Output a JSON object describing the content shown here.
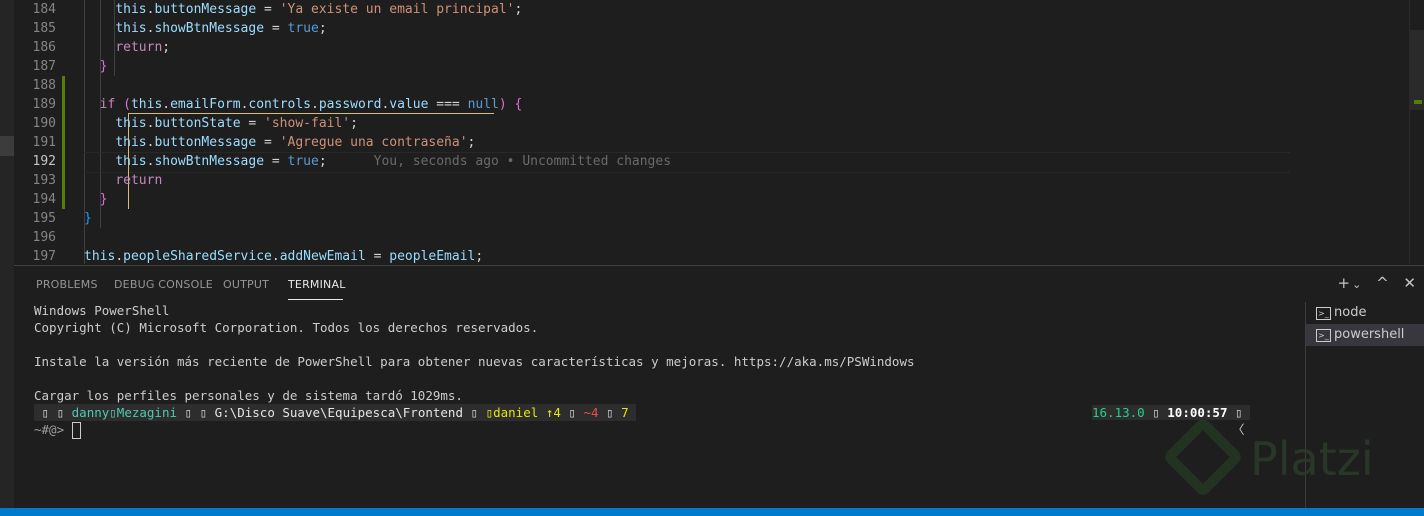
{
  "editor": {
    "lines": [
      {
        "n": "184",
        "indent": "    ",
        "tokens": [
          [
            "prop",
            "this"
          ],
          [
            "d",
            "."
          ],
          [
            "prop",
            "buttonMessage"
          ],
          [
            "d",
            " = "
          ],
          [
            "str",
            "'Ya existe un email principal'"
          ],
          [
            "d",
            ";"
          ]
        ]
      },
      {
        "n": "185",
        "indent": "    ",
        "tokens": [
          [
            "prop",
            "this"
          ],
          [
            "d",
            "."
          ],
          [
            "prop",
            "showBtnMessage"
          ],
          [
            "d",
            " = "
          ],
          [
            "kw",
            "true"
          ],
          [
            "d",
            ";"
          ]
        ]
      },
      {
        "n": "186",
        "indent": "    ",
        "tokens": [
          [
            "ctl",
            "return"
          ],
          [
            "d",
            ";"
          ]
        ]
      },
      {
        "n": "187",
        "indent": "  ",
        "tokens": [
          [
            "brace2",
            "}"
          ]
        ]
      },
      {
        "n": "188",
        "indent": "",
        "tokens": []
      },
      {
        "n": "189",
        "indent": "  ",
        "tokens": [
          [
            "ctl",
            "if"
          ],
          [
            "d",
            " "
          ],
          [
            "brace2",
            "("
          ],
          [
            "prop",
            "this"
          ],
          [
            "d",
            "."
          ],
          [
            "prop",
            "emailForm"
          ],
          [
            "d",
            "."
          ],
          [
            "prop",
            "controls"
          ],
          [
            "d",
            "."
          ],
          [
            "prop",
            "password"
          ],
          [
            "d",
            "."
          ],
          [
            "prop",
            "value"
          ],
          [
            "d",
            " === "
          ],
          [
            "kw",
            "null"
          ],
          [
            "brace2",
            ")"
          ],
          [
            "d",
            " "
          ],
          [
            "brace2",
            "{"
          ]
        ]
      },
      {
        "n": "190",
        "indent": "    ",
        "tokens": [
          [
            "prop",
            "this"
          ],
          [
            "d",
            "."
          ],
          [
            "prop",
            "buttonState"
          ],
          [
            "d",
            " = "
          ],
          [
            "str",
            "'show-fail'"
          ],
          [
            "d",
            ";"
          ]
        ]
      },
      {
        "n": "191",
        "indent": "    ",
        "tokens": [
          [
            "prop",
            "this"
          ],
          [
            "d",
            "."
          ],
          [
            "prop",
            "buttonMessage"
          ],
          [
            "d",
            " = "
          ],
          [
            "str",
            "'Agregue una contraseña'"
          ],
          [
            "d",
            ";"
          ]
        ]
      },
      {
        "n": "192",
        "indent": "    ",
        "tokens": [
          [
            "prop",
            "this"
          ],
          [
            "d",
            "."
          ],
          [
            "prop",
            "showBtnMessage"
          ],
          [
            "d",
            " = "
          ],
          [
            "kw",
            "true"
          ],
          [
            "d",
            ";"
          ]
        ],
        "blame": "You, seconds ago • Uncommitted changes"
      },
      {
        "n": "193",
        "indent": "    ",
        "tokens": [
          [
            "ctl",
            "return"
          ]
        ]
      },
      {
        "n": "194",
        "indent": "  ",
        "tokens": [
          [
            "brace2",
            "}"
          ]
        ]
      },
      {
        "n": "195",
        "indent": "",
        "tokens": [
          [
            "brace3",
            "}"
          ]
        ]
      },
      {
        "n": "196",
        "indent": "",
        "tokens": []
      },
      {
        "n": "197",
        "indent": "",
        "tokens": [
          [
            "prop",
            "this"
          ],
          [
            "d",
            "."
          ],
          [
            "prop",
            "peopleSharedService"
          ],
          [
            "d",
            "."
          ],
          [
            "prop",
            "addNewEmail"
          ],
          [
            "d",
            " = "
          ],
          [
            "prop",
            "peopleEmail"
          ],
          [
            "d",
            ";"
          ]
        ]
      }
    ],
    "active_line": "192"
  },
  "panel": {
    "tabs": [
      {
        "label": "PROBLEMS",
        "active": false
      },
      {
        "label": "DEBUG CONSOLE",
        "active": false
      },
      {
        "label": "OUTPUT",
        "active": false
      },
      {
        "label": "TERMINAL",
        "active": true
      }
    ],
    "actions": {
      "add": "+",
      "dropdown": "⌄",
      "maximize": "^",
      "close": "✕"
    }
  },
  "terminal": {
    "lines": [
      "Windows PowerShell",
      "Copyright (C) Microsoft Corporation. Todos los derechos reservados.",
      "",
      "Instale la versión más reciente de PowerShell para obtener nuevas características y mejoras. https://aka.ms/PSWindows",
      "",
      "Cargar los perfiles personales y de sistema tardó 1029ms."
    ],
    "prompt": {
      "user": "danny▯Mezagini",
      "path": "G:\\Disco Suave\\Equipesca\\Frontend",
      "branch": "▯daniel",
      "ahead": "↑4",
      "modified": "~4",
      "count": "7",
      "node_version": "16.13.0",
      "time": "10:00:57",
      "second_line": "~#@>",
      "right_glyph": "〈"
    },
    "instances": [
      {
        "label": "node",
        "selected": false
      },
      {
        "label": "powershell",
        "selected": true
      }
    ]
  },
  "watermark": "Platzi",
  "colors": {
    "accent": "#007acc",
    "git_added": "#587c0c",
    "selection_border": "#d7ba7d"
  }
}
